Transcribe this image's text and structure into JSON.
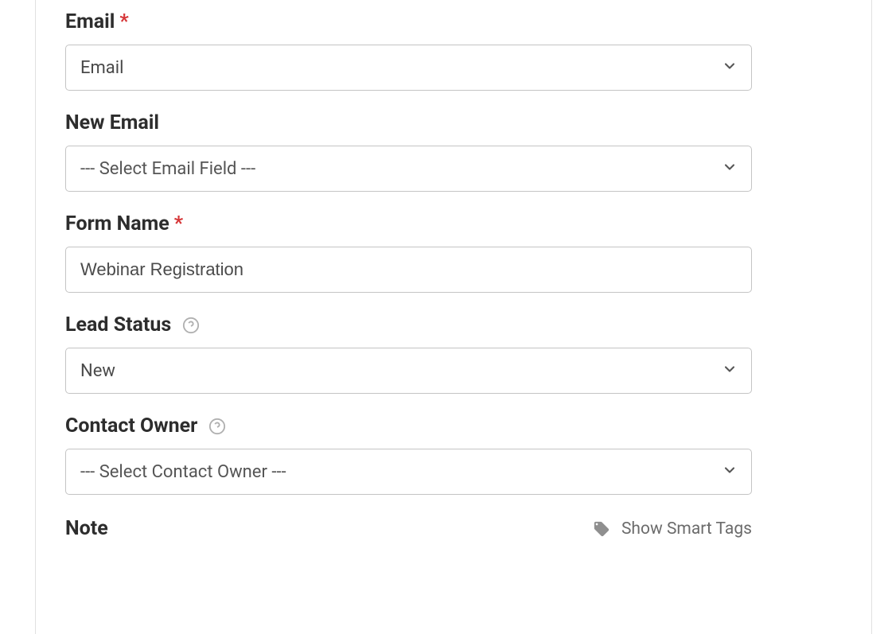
{
  "fields": {
    "email": {
      "label": "Email",
      "required": true,
      "value": "Email"
    },
    "new_email": {
      "label": "New Email",
      "required": false,
      "value": "--- Select Email Field ---"
    },
    "form_name": {
      "label": "Form Name",
      "required": true,
      "value": "Webinar Registration"
    },
    "lead_status": {
      "label": "Lead Status",
      "required": false,
      "has_help": true,
      "value": "New"
    },
    "contact_owner": {
      "label": "Contact Owner",
      "required": false,
      "has_help": true,
      "value": "--- Select Contact Owner ---"
    },
    "note": {
      "label": "Note"
    }
  },
  "smart_tags_link": "Show Smart Tags",
  "required_marker": "*"
}
